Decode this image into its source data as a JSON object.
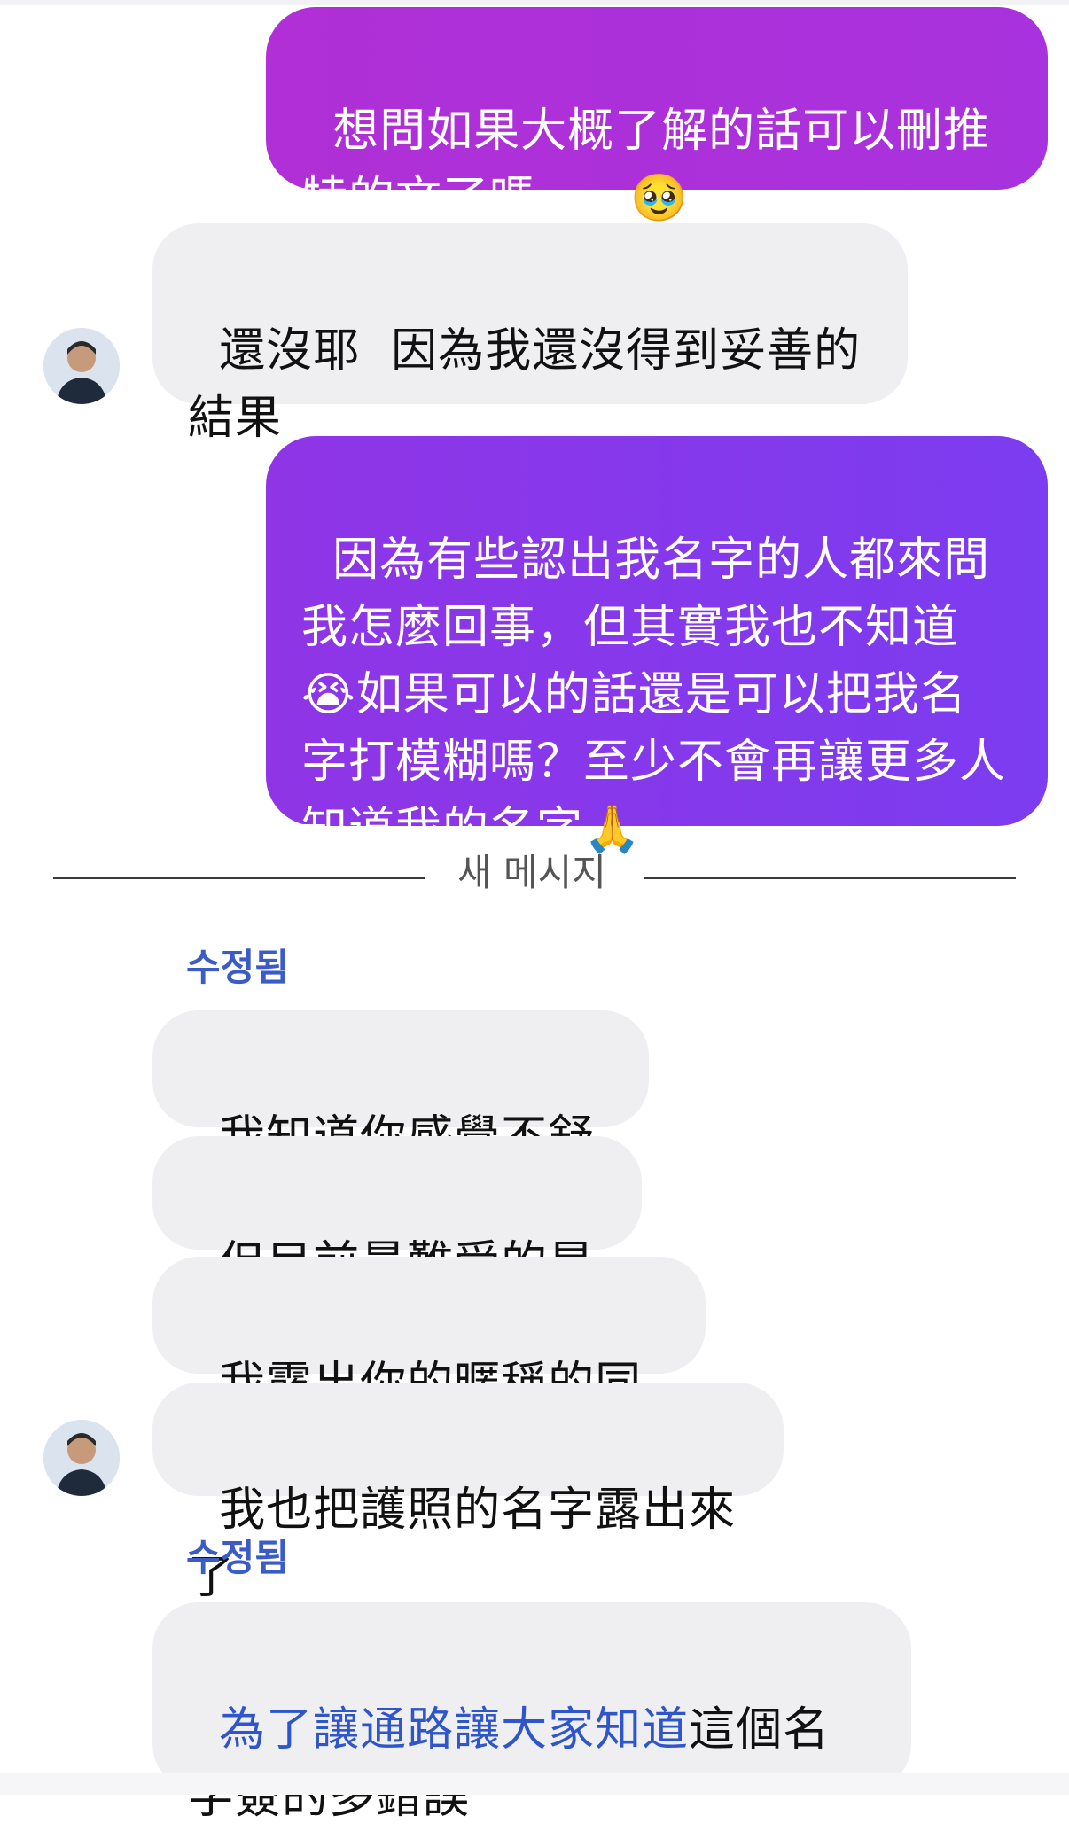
{
  "conversation": {
    "messages": [
      {
        "side": "out",
        "text": "想問如果大概了解的話可以刪推特的文了嗎～～🥹"
      },
      {
        "side": "in",
        "text": "還沒耶  因為我還沒得到妥善的結果"
      },
      {
        "side": "out",
        "text": "因為有些認出我名字的人都來問我怎麼回事，但其實我也不知道😭如果可以的話還是可以把我名字打模糊嗎？至少不會再讓更多人知道我的名字🙏"
      }
    ],
    "divider_label": "새 메시지",
    "edited_label": "수정됨",
    "group_messages": [
      {
        "side": "in",
        "text": "我知道你感覺不舒服"
      },
      {
        "side": "in",
        "text": "但目前最難受的是我"
      },
      {
        "side": "in",
        "text": "我露出你的暱稱的同時"
      },
      {
        "side": "in",
        "text": "我也把護照的名字露出來了"
      }
    ],
    "last_message": {
      "side": "in",
      "link_text": "為了讓通路讓大家知道",
      "text": "這個名字簽的多錯誤"
    }
  },
  "colors": {
    "outgoing_gradient_start": "#b02fd6",
    "outgoing_gradient_end": "#7f3bf0",
    "incoming_bg": "#efeff2",
    "edited_text": "#3b5bc6",
    "link_text": "#2e55c9"
  },
  "icons": {
    "avatar": "contact-avatar-icon"
  }
}
